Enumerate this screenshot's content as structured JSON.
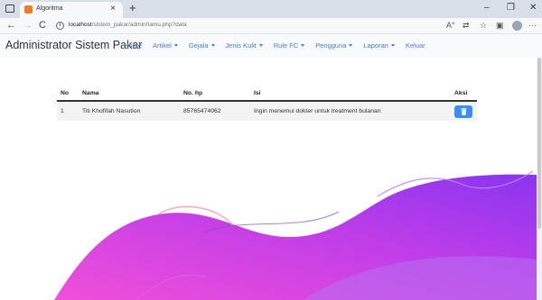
{
  "browser": {
    "tab_title": "Algoritma",
    "tab_close": "×",
    "new_tab": "+",
    "window_controls": {
      "minimize": "–",
      "maximize": "❐",
      "close": "✕"
    },
    "nav": {
      "back": "←",
      "forward": "→",
      "reload": "C"
    },
    "url_host": "localhost",
    "url_path": "/sistem_pakar/admin/tamu.php?data",
    "icons": [
      "read-aloud-icon",
      "translate-icon",
      "favorites-icon",
      "collections-icon",
      "profile-icon",
      "more-icon"
    ]
  },
  "app": {
    "brand": "Administrator Sistem Pakar",
    "nav": [
      {
        "label": "Home",
        "dropdown": false
      },
      {
        "label": "Artikel",
        "dropdown": true
      },
      {
        "label": "Gejala",
        "dropdown": true
      },
      {
        "label": "Jenis Kulit",
        "dropdown": true
      },
      {
        "label": "Rule FC",
        "dropdown": true
      },
      {
        "label": "Pengguna",
        "dropdown": true
      },
      {
        "label": "Laporan",
        "dropdown": true
      },
      {
        "label": "Keluar",
        "dropdown": false
      }
    ],
    "link_color": "#4a7fd0"
  },
  "table": {
    "headers": {
      "no": "No",
      "nama": "Nama",
      "hp": "No. hp",
      "isi": "Isi",
      "aksi": "Aksi"
    },
    "rows": [
      {
        "no": "1",
        "nama": "Titi Khofifah Nasution",
        "hp": "85765474062",
        "isi": "Ingin menemui dokter untuk treatment bulanan",
        "action_icon": "trash-icon"
      }
    ],
    "delete_button_color": "#3a8ff5"
  },
  "colors": {
    "gradient_start": "#f04fd9",
    "gradient_end": "#8a35f0"
  }
}
